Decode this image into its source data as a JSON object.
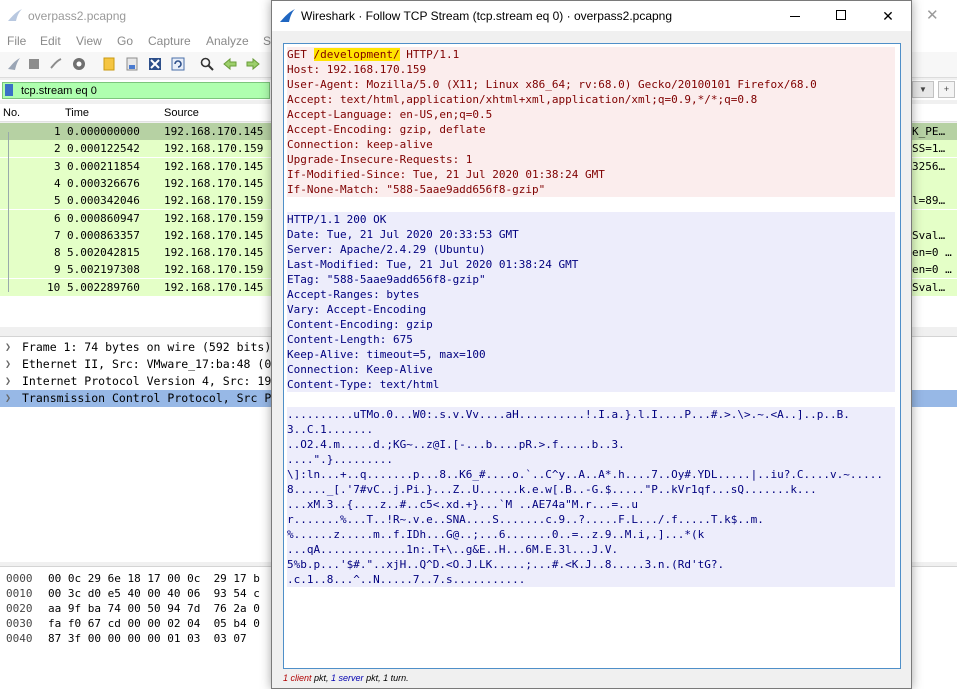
{
  "main": {
    "title": "overpass2.pcapng",
    "menu": [
      "File",
      "Edit",
      "View",
      "Go",
      "Capture",
      "Analyze",
      "S"
    ],
    "filter_value": "tcp.stream eq 0",
    "columns": [
      "No.",
      "Time",
      "Source"
    ],
    "packets": [
      {
        "no": "1",
        "time": "0.000000000",
        "src": "192.168.170.145",
        "info": "K_PE…"
      },
      {
        "no": "2",
        "time": "0.000122542",
        "src": "192.168.170.159",
        "info": "SS=1…"
      },
      {
        "no": "3",
        "time": "0.000211854",
        "src": "192.168.170.145",
        "info": "3256…"
      },
      {
        "no": "4",
        "time": "0.000326676",
        "src": "192.168.170.145",
        "info": ""
      },
      {
        "no": "5",
        "time": "0.000342046",
        "src": "192.168.170.159",
        "info": "l=89…"
      },
      {
        "no": "6",
        "time": "0.000860947",
        "src": "192.168.170.159",
        "info": ""
      },
      {
        "no": "7",
        "time": "0.000863357",
        "src": "192.168.170.145",
        "info": "Sval…"
      },
      {
        "no": "8",
        "time": "5.002042815",
        "src": "192.168.170.145",
        "info": "en=0 …"
      },
      {
        "no": "9",
        "time": "5.002197308",
        "src": "192.168.170.159",
        "info": "en=0 …"
      },
      {
        "no": "10",
        "time": "5.002289760",
        "src": "192.168.170.145",
        "info": "Sval…"
      }
    ],
    "details": [
      "Frame 1: 74 bytes on wire (592 bits)",
      "Ethernet II, Src: VMware_17:ba:48 (0",
      "Internet Protocol Version 4, Src: 19",
      "Transmission Control Protocol, Src P"
    ],
    "hex": [
      {
        "off": "0000",
        "bytes": "00 0c 29 6e 18 17 00 0c  29 17 b"
      },
      {
        "off": "0010",
        "bytes": "00 3c d0 e5 40 00 40 06  93 54 c"
      },
      {
        "off": "0020",
        "bytes": "aa 9f ba 74 00 50 94 7d  76 2a 0"
      },
      {
        "off": "0030",
        "bytes": "fa f0 67 cd 00 00 02 04  05 b4 0"
      },
      {
        "off": "0040",
        "bytes": "87 3f 00 00 00 00 01 03  03 07"
      }
    ]
  },
  "dialog": {
    "title": "Wireshark · Follow TCP Stream (tcp.stream eq 0) · overpass2.pcapng",
    "request_first": {
      "method": "GET ",
      "path": "/development/",
      "proto": " HTTP/1.1"
    },
    "request_lines": [
      "Host: 192.168.170.159",
      "User-Agent: Mozilla/5.0 (X11; Linux x86_64; rv:68.0) Gecko/20100101 Firefox/68.0",
      "Accept: text/html,application/xhtml+xml,application/xml;q=0.9,*/*;q=0.8",
      "Accept-Language: en-US,en;q=0.5",
      "Accept-Encoding: gzip, deflate",
      "Connection: keep-alive",
      "Upgrade-Insecure-Requests: 1",
      "If-Modified-Since: Tue, 21 Jul 2020 01:38:24 GMT",
      "If-None-Match: \"588-5aae9add656f8-gzip\""
    ],
    "response_lines": [
      "HTTP/1.1 200 OK",
      "Date: Tue, 21 Jul 2020 20:33:53 GMT",
      "Server: Apache/2.4.29 (Ubuntu)",
      "Last-Modified: Tue, 21 Jul 2020 01:38:24 GMT",
      "ETag: \"588-5aae9add656f8-gzip\"",
      "Accept-Ranges: bytes",
      "Vary: Accept-Encoding",
      "Content-Encoding: gzip",
      "Content-Length: 675",
      "Keep-Alive: timeout=5, max=100",
      "Connection: Keep-Alive",
      "Content-Type: text/html"
    ],
    "body_lines": [
      "..........uTMo.0...W0:.s.v.Vv....aH..........!.I.a.}.l.I....P...#.>.\\>.~.<A..]..p..B.",
      "3..C.1.......",
      "..O2.4.m.....d.;KG~..z@I.[-...b....pR.>.f.....b..3.",
      "....\".}.........",
      "\\]:ln...+..q.......p...8..K6_#....o.`..C^y..A..A*.h....7..Oy#.YDL.....|..iu?.C....v.~.....",
      "8....._[.'7#vC..j.Pi.}...Z..U......k.e.w[.B..-G.$.....\"P..kVr1qf...sQ.......k...",
      "...xM.3..{....z..#..c5<.xd.+}...`M ..AE74a\"M.r...=..u",
      "r.......%...T..!R~.v.e..SNA....S.......c.9..?.....F.L.../.f.....T.k$..m.",
      "%......z.....m..f.IDh...G@..;...6.......0..=..z.9..M.i,.]...*(k",
      "...qA.............1n:.T+\\..g&E..H...6M.E.3l...J.V.",
      "5%b.p...'$#.\"..xjH..Q^D.<O.J.LK.....;...#.<K.J..8.....3.n.(Rd'tG?.",
      ".c.1..8...^..N.....7..7.s..........."
    ],
    "status": {
      "client": "1 client",
      "pkt1": " pkt, ",
      "server": "1 server",
      "rest": " pkt, 1 turn."
    }
  }
}
